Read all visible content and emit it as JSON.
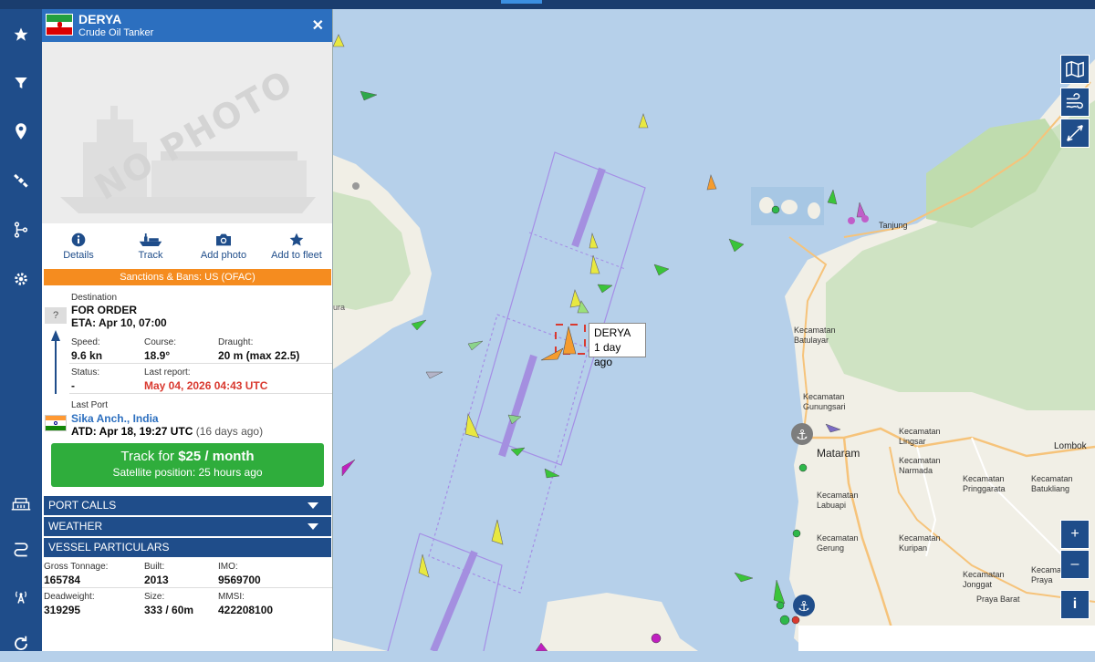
{
  "vessel": {
    "name": "DERYA",
    "type": "Crude Oil Tanker",
    "photo_placeholder": "NO PHOTO",
    "sanctions": "Sanctions & Bans: US (OFAC)",
    "destination_label": "Destination",
    "destination": "FOR ORDER",
    "eta": "ETA: Apr 10, 07:00",
    "unknown_mark": "?",
    "speed_label": "Speed:",
    "speed": "9.6 kn",
    "course_label": "Course:",
    "course": "18.9°",
    "draught_label": "Draught:",
    "draught": "20 m (max 22.5)",
    "status_label": "Status:",
    "status": "-",
    "last_report_label": "Last report:",
    "last_report": "May 04, 2026 04:43 UTC",
    "last_port_label": "Last Port",
    "last_port": "Sika Anch., India",
    "atd": "ATD: Apr 18, 19:27 UTC",
    "atd_ago": "(16 days ago)"
  },
  "actions": {
    "details": "Details",
    "track": "Track",
    "add_photo": "Add photo",
    "add_to_fleet": "Add to fleet"
  },
  "track_button": {
    "prefix": "Track for ",
    "price": "$25 / month",
    "subtitle": "Satellite position: 25 hours ago"
  },
  "sections": {
    "port_calls": "PORT CALLS",
    "weather": "WEATHER",
    "vessel_particulars": "VESSEL PARTICULARS"
  },
  "particulars": {
    "gross_tonnage_label": "Gross Tonnage:",
    "gross_tonnage": "165784",
    "built_label": "Built:",
    "built": "2013",
    "imo_label": "IMO:",
    "imo": "9569700",
    "deadweight_label": "Deadweight:",
    "deadweight": "319295",
    "size_label": "Size:",
    "size": "333 / 60m",
    "mmsi_label": "MMSI:",
    "mmsi": "422208100"
  },
  "map": {
    "tooltip_name": "DERYA",
    "tooltip_time": "1 day ago",
    "places": {
      "tanjung": "Tanjung",
      "batulayar": "Kecamatan Batulayar",
      "gunungsari": "Kecamatan Gunungsari",
      "mataram": "Mataram",
      "lingsar": "Kecamatan Lingsar",
      "narmada": "Kecamatan Narmada",
      "lombok": "Lombok",
      "labuapi": "Kecamatan Labuapi",
      "pringgarata": "Kecamatan Pringgarata",
      "batukliang": "Kecamatan Batukliang",
      "gerung": "Kecamatan Gerung",
      "kuripan": "Kecamatan Kuripan",
      "jonggat": "Kecamatan Jonggat",
      "praya": "Kecamatan Praya",
      "praya_barat": "Praya Barat",
      "ura": "ura"
    },
    "controls": {
      "zoom_in": "+",
      "zoom_out": "–",
      "info": "i"
    }
  },
  "colors": {
    "nav": "#1f4d8a",
    "header": "#2c6fbf",
    "sanction": "#f58c1f",
    "track": "#2fad3c",
    "report": "#d9392f",
    "sea": "#b6d0ea",
    "land": "#f1efe6"
  }
}
